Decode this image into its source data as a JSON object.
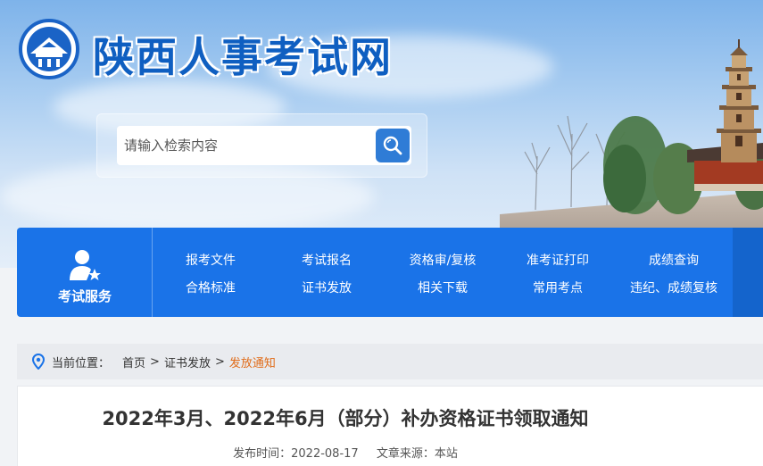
{
  "site": {
    "title": "陕西人事考试网",
    "logo_icon": "pagoda-emblem-icon"
  },
  "search": {
    "placeholder": "请输入检索内容",
    "button_icon": "search-icon"
  },
  "nav": {
    "service_label": "考试服务",
    "service_icon": "user-star-icon",
    "row1": [
      "报考文件",
      "考试报名",
      "资格审/复核",
      "准考证打印",
      "成绩查询"
    ],
    "row2": [
      "合格标准",
      "证书发放",
      "相关下载",
      "常用考点",
      "违纪、成绩复核"
    ]
  },
  "breadcrumb": {
    "prefix": "当前位置：",
    "items": [
      "首页",
      "证书发放"
    ],
    "current": "发放通知",
    "separator": ">"
  },
  "article": {
    "title": "2022年3月、2022年6月（部分）补办资格证书领取通知",
    "publish_label": "发布时间：",
    "publish_date": "2022-08-17",
    "source_label": "文章来源：",
    "source": "本站"
  },
  "colors": {
    "brand_blue": "#1a73e8",
    "title_blue": "#0f5fc1",
    "current_orange": "#e06c1a"
  }
}
